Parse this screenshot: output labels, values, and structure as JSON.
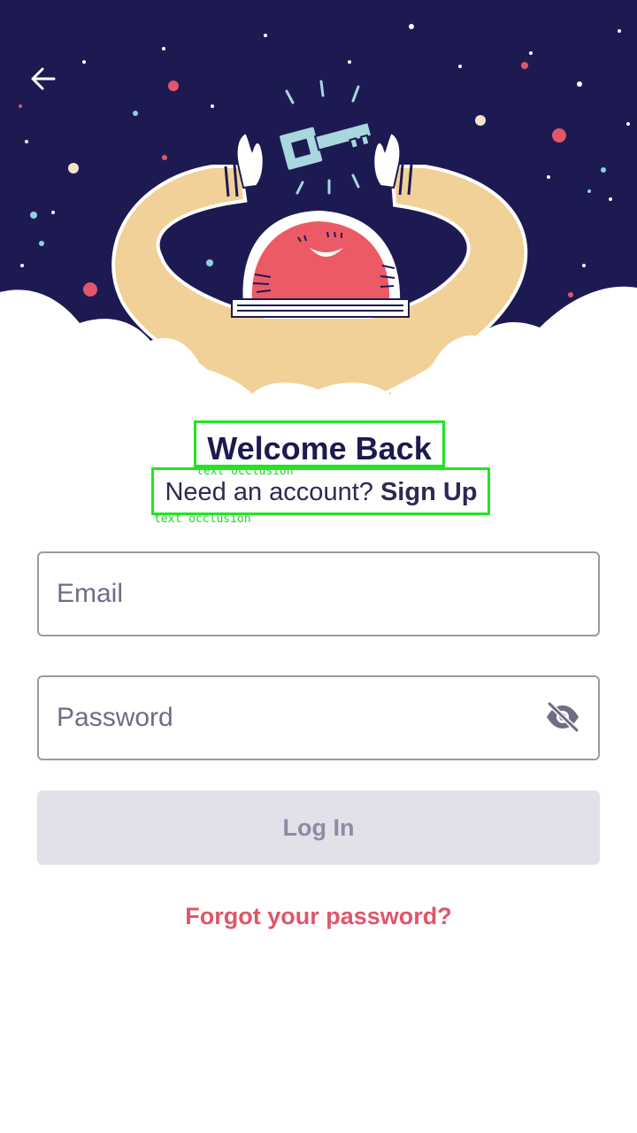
{
  "colors": {
    "sky": "#1d1a52",
    "cloud": "#ffffff",
    "arms": "#f1d197",
    "face": "#ec5a66",
    "key": "#a8d7de",
    "heading": "#1c1a4f",
    "link_accent": "#e0566a",
    "button_disabled_bg": "#e2e1ea",
    "button_disabled_text": "#8d8ba4",
    "field_border": "#9a9aa4",
    "annotation_box": "#22e522"
  },
  "header": {
    "back_icon": "arrow-left-icon"
  },
  "hero": {
    "illustration": "character holding key under starry sky"
  },
  "welcome": {
    "title": "Welcome Back",
    "subtitle_prefix": "Need an account? ",
    "signup_link": "Sign Up"
  },
  "annotations": {
    "title_label": "text occlusion",
    "subtitle_label": "text occlusion"
  },
  "form": {
    "email_placeholder": "Email",
    "email_value": "",
    "password_placeholder": "Password",
    "password_value": "",
    "password_toggle_icon": "eye-off-icon",
    "login_label": "Log In",
    "forgot_label": "Forgot your password?"
  }
}
